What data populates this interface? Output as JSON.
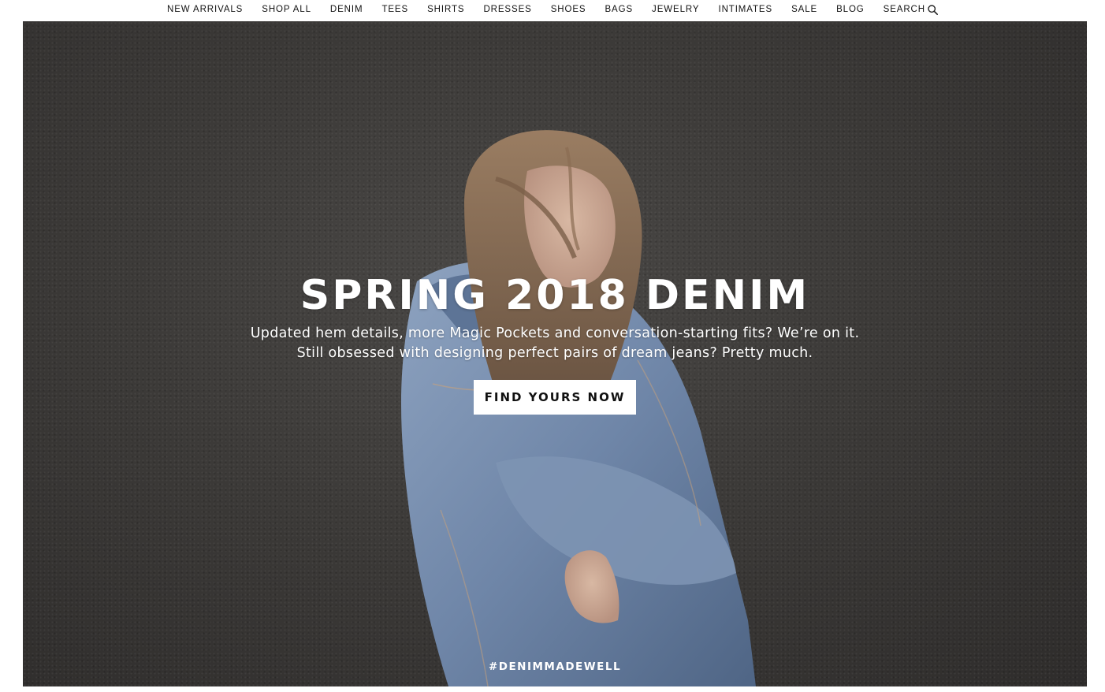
{
  "nav": {
    "items": [
      {
        "label": "NEW ARRIVALS"
      },
      {
        "label": "SHOP ALL"
      },
      {
        "label": "DENIM"
      },
      {
        "label": "TEES"
      },
      {
        "label": "SHIRTS"
      },
      {
        "label": "DRESSES"
      },
      {
        "label": "SHOES"
      },
      {
        "label": "BAGS"
      },
      {
        "label": "JEWELRY"
      },
      {
        "label": "INTIMATES"
      },
      {
        "label": "SALE"
      },
      {
        "label": "BLOG"
      }
    ],
    "search_label": "SEARCH",
    "search_icon": "magnifier-icon"
  },
  "hero": {
    "headline": "SPRING 2018 DENIM",
    "subcopy_line1": "Updated hem details, more Magic Pockets and conversation-starting fits? We’re on it.",
    "subcopy_line2": "Still obsessed with designing perfect pairs of dream jeans? Pretty much.",
    "cta_label": "FIND YOURS NOW",
    "hashtag": "#DENIMMADEWELL"
  },
  "colors": {
    "background": "#ffffff",
    "hero_wall": "#3c3a38",
    "denim": "#6f86a8",
    "text_light": "#ffffff",
    "text_dark": "#111111"
  }
}
